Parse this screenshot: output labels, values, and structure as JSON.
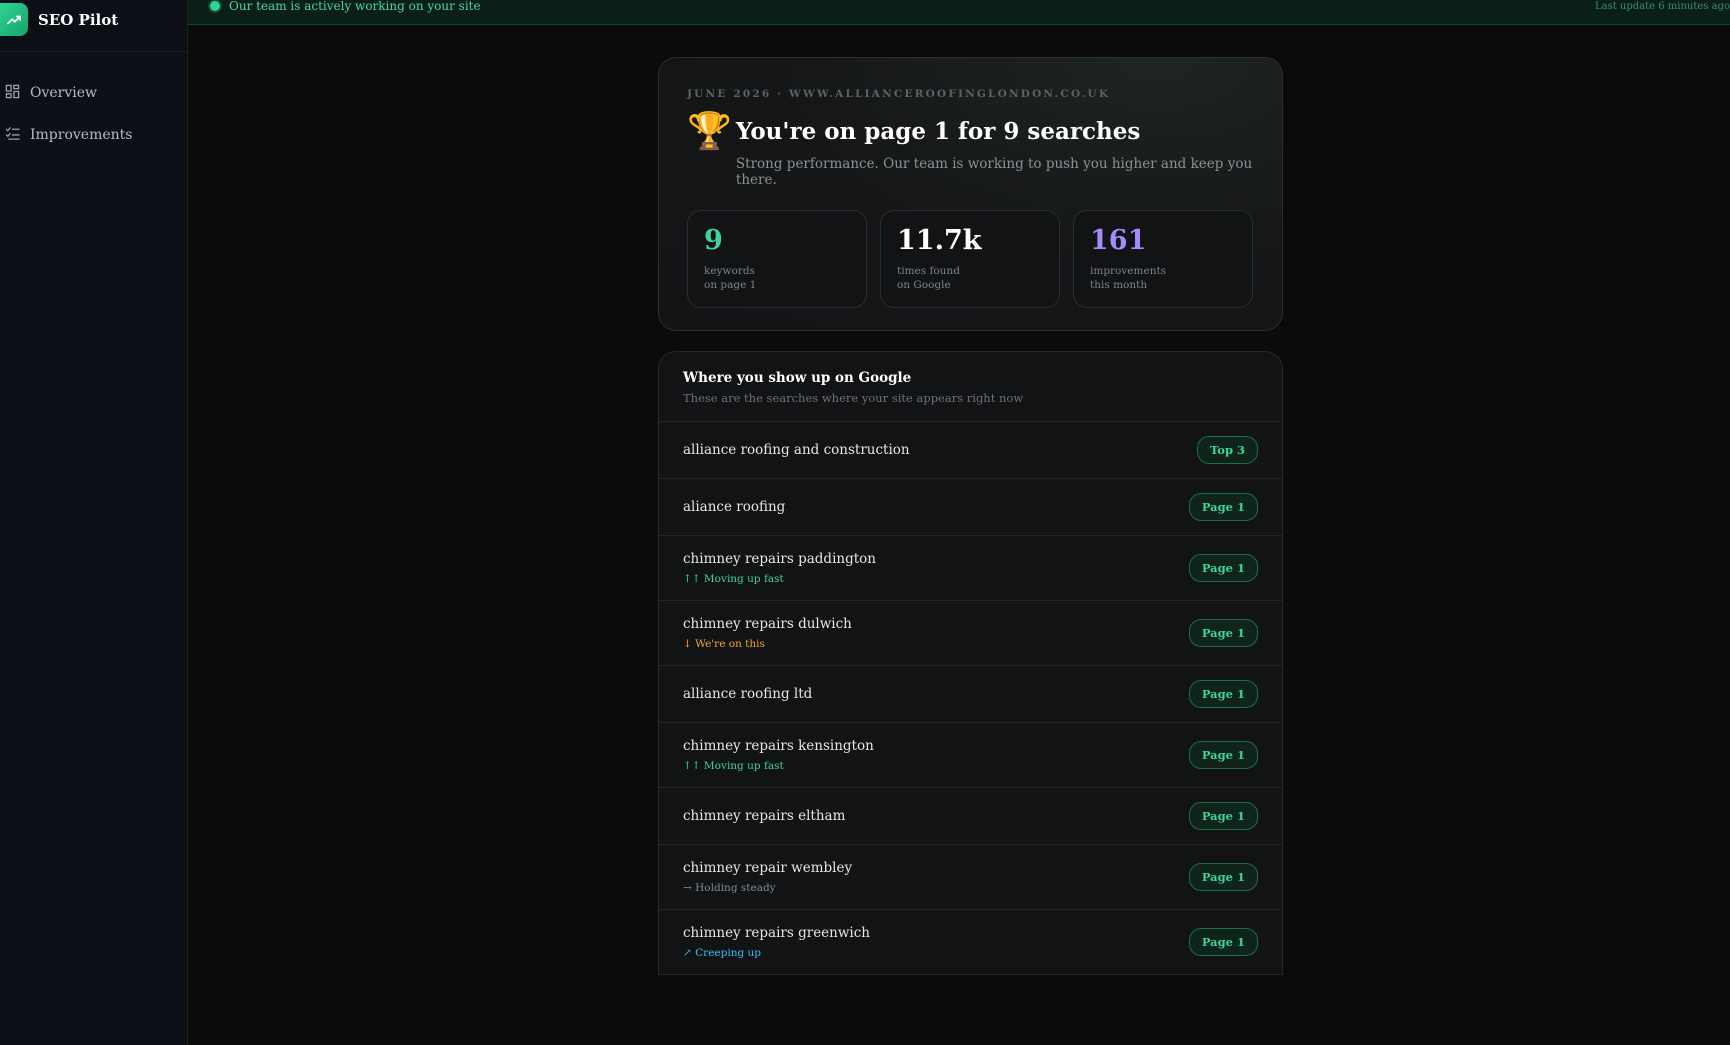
{
  "app": {
    "name": "SEO Pilot"
  },
  "nav": [
    {
      "label": "Overview",
      "icon": "grid-icon"
    },
    {
      "label": "Improvements",
      "icon": "checklist-icon"
    }
  ],
  "banner": {
    "status": "Our team is actively working on your site",
    "last_update": "Last update 6 minutes ago"
  },
  "hero": {
    "eyebrow": "JUNE 2026 · WWW.ALLIANCEROOFINGLONDON.CO.UK",
    "title": "You're on page 1 for 9 searches",
    "subtitle": "Strong performance. Our team is working to push you higher and keep you there.",
    "stats": [
      {
        "value": "9",
        "label1": "keywords",
        "label2": "on page 1",
        "color": "#3fd49a"
      },
      {
        "value": "11.7k",
        "label1": "times found",
        "label2": "on Google",
        "color": "#ffffff"
      },
      {
        "value": "161",
        "label1": "improvements",
        "label2": "this month",
        "color": "#a78bfa"
      }
    ]
  },
  "rankings": {
    "title": "Where you show up on Google",
    "subtitle": "These are the searches where your site appears right now",
    "rows": [
      {
        "term": "alliance roofing and construction",
        "trend": "",
        "badge": "Top 3"
      },
      {
        "term": "aliance roofing",
        "trend": "",
        "badge": "Page 1"
      },
      {
        "term": "chimney repairs paddington",
        "trend": "↑↑ Moving up fast",
        "trend_color": "#3fd49a",
        "badge": "Page 1"
      },
      {
        "term": "chimney repairs dulwich",
        "trend": "↓ We're on this",
        "trend_color": "#f5a524",
        "badge": "Page 1"
      },
      {
        "term": "alliance roofing ltd",
        "trend": "",
        "badge": "Page 1"
      },
      {
        "term": "chimney repairs kensington",
        "trend": "↑↑ Moving up fast",
        "trend_color": "#3fd49a",
        "badge": "Page 1"
      },
      {
        "term": "chimney repairs eltham",
        "trend": "",
        "badge": "Page 1"
      },
      {
        "term": "chimney repair wembley",
        "trend": "→ Holding steady",
        "trend_color": "#858b91",
        "badge": "Page 1"
      },
      {
        "term": "chimney repairs greenwich",
        "trend": "↗ Creeping up",
        "trend_color": "#38bdf8",
        "badge": "Page 1"
      }
    ]
  }
}
